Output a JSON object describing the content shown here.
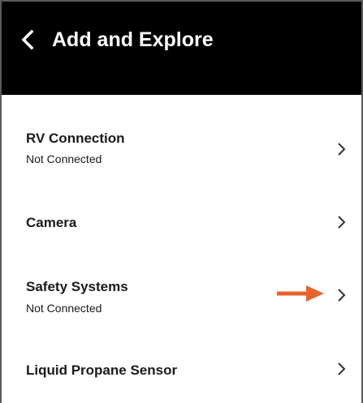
{
  "header": {
    "title": "Add and Explore",
    "back_icon": "chevron-left-icon",
    "background": "#000000",
    "text_color": "#ffffff"
  },
  "list": {
    "items": [
      {
        "title": "RV Connection",
        "subtitle": "Not Connected",
        "icon": "chevron-right-icon"
      },
      {
        "title": "Camera",
        "subtitle": "",
        "icon": "chevron-right-icon"
      },
      {
        "title": "Safety Systems",
        "subtitle": "Not Connected",
        "icon": "chevron-right-icon"
      },
      {
        "title": "Liquid Propane Sensor",
        "subtitle": "",
        "icon": "chevron-right-icon"
      }
    ]
  },
  "annotation": {
    "icon": "arrow-right-icon",
    "color": "#e8632b"
  }
}
